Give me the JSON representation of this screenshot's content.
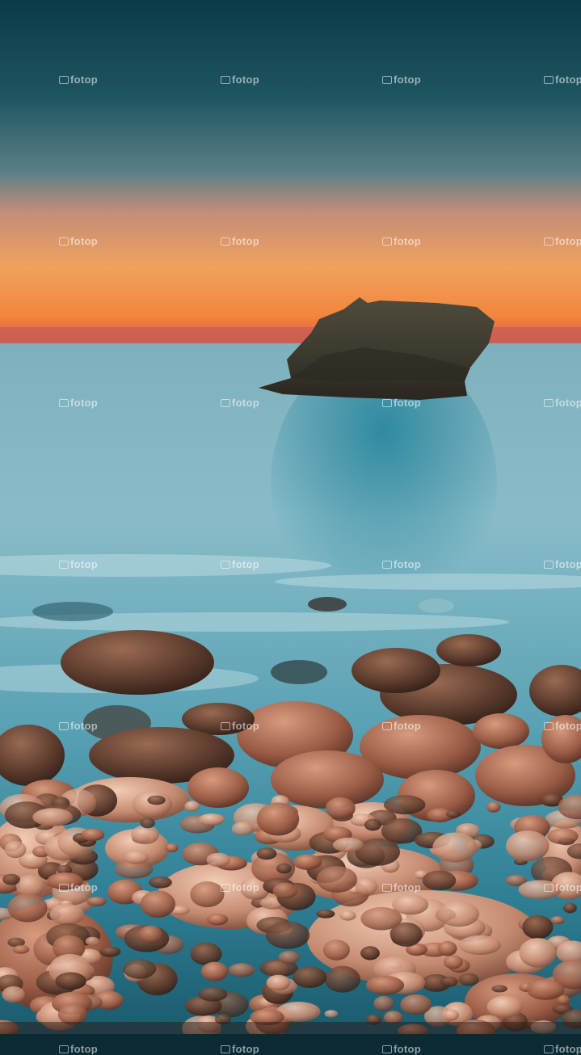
{
  "image": {
    "description_colors": {
      "sky_top": "#0f3a45",
      "sky_mid": "#2a5f68",
      "horizon_warm": "#f2a15a",
      "horizon_glow": "#f07a3c",
      "horizon_red": "#d9574a",
      "sea": "#4fa3b5",
      "sea_deep": "#1f6f84",
      "rock": "#3d3a30",
      "pebble": "#a86b53"
    }
  },
  "watermark": {
    "text": "fotop",
    "rows": [
      0,
      1,
      2,
      3,
      4,
      5,
      6
    ]
  }
}
